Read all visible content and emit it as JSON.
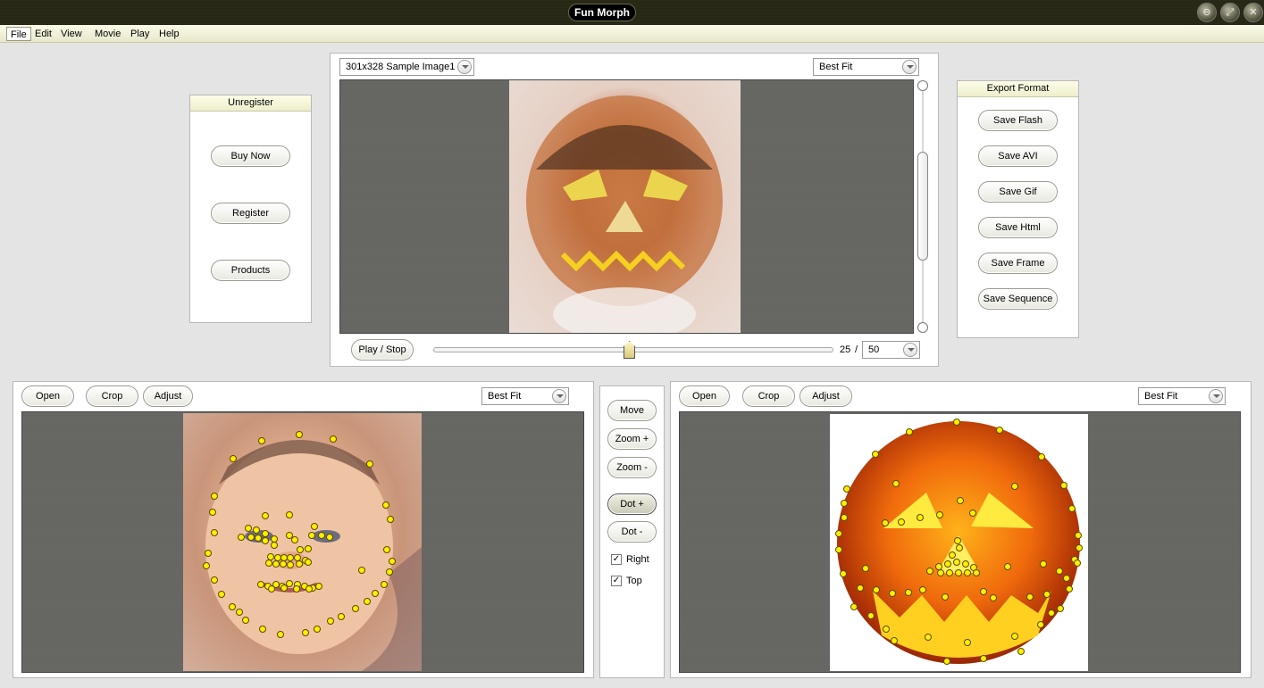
{
  "window": {
    "title": "Fun Morph",
    "buttons": {
      "minimize": "⊖",
      "maximize": "⤢",
      "close": "✕"
    }
  },
  "menu": [
    "File",
    "Edit",
    "View",
    "Movie",
    "Play",
    "Help"
  ],
  "unregister": {
    "title": "Unregister",
    "buttons": [
      "Buy Now",
      "Register",
      "Products"
    ]
  },
  "preview": {
    "source_select": "301x328 Sample Image1",
    "fit_select": "Best Fit",
    "play_label": "Play / Stop",
    "frame_current": "25",
    "frame_sep": "/",
    "frame_total": "50",
    "frame_progress": 0.5
  },
  "export": {
    "title": "Export Format",
    "buttons": [
      "Save Flash",
      "Save AVI",
      "Save Gif",
      "Save Html",
      "Save Frame",
      "Save Sequence"
    ]
  },
  "left_editor": {
    "buttons": [
      "Open",
      "Crop",
      "Adjust"
    ],
    "fit_select": "Best Fit"
  },
  "tools": {
    "buttons": [
      "Move",
      "Zoom +",
      "Zoom -",
      "Dot +",
      "Dot -"
    ],
    "checks": [
      {
        "label": "Right",
        "checked": true
      },
      {
        "label": "Top",
        "checked": true
      }
    ]
  },
  "right_editor": {
    "buttons": [
      "Open",
      "Crop",
      "Adjust"
    ],
    "fit_select": "Best Fit"
  },
  "colors": {
    "dot_fill": "#ffee00",
    "canvas_bg": "#636360",
    "titlebar": "#1a1a0a"
  }
}
